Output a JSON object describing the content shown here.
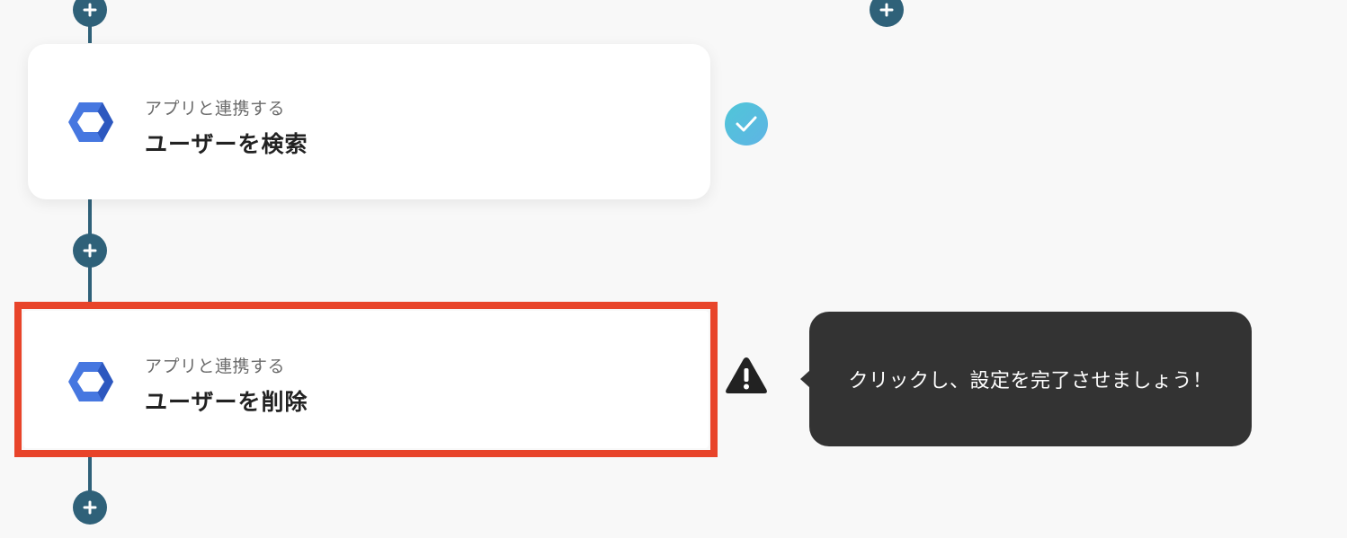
{
  "colors": {
    "connector": "#2f6179",
    "highlight": "#e8442a",
    "tooltip_bg": "#333333",
    "check_gradient": [
      "#4fc6d8",
      "#5fb4e4"
    ],
    "app_icon_blue": "#4677e0"
  },
  "icons": {
    "add": "plus-icon",
    "done": "check-icon",
    "warning": "warning-icon",
    "app": "hexagon-app-icon"
  },
  "steps": [
    {
      "subtitle": "アプリと連携する",
      "title": "ユーザーを検索",
      "status": "complete"
    },
    {
      "subtitle": "アプリと連携する",
      "title": "ユーザーを削除",
      "status": "warning"
    }
  ],
  "tooltip": {
    "text": "クリックし、設定を完了させましょう！"
  }
}
